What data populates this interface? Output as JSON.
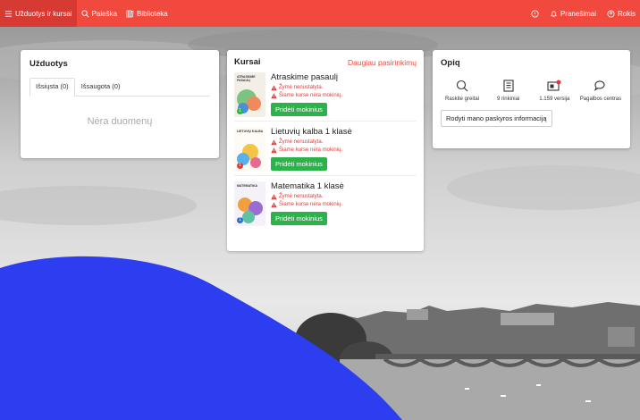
{
  "colors": {
    "brand": "#f2493f",
    "brand_dark": "#d73a32",
    "success": "#2bb34a",
    "warning": "#e53935",
    "blob": "#2c3ef0"
  },
  "topbar": {
    "items": [
      {
        "label": "Užduotys ir kursai",
        "icon": "list-icon"
      },
      {
        "label": "Paieška",
        "icon": "search-icon"
      },
      {
        "label": "Biblioteka",
        "icon": "books-icon"
      }
    ],
    "right": {
      "help_icon": "help-icon",
      "notifications_label": "Pranešimai",
      "user_label": "Rokis"
    }
  },
  "tasks": {
    "title": "Užduotys",
    "tabs": [
      "Išsiųsta (0)",
      "Išsaugota (0)"
    ],
    "empty_text": "Nėra duomenų"
  },
  "courses": {
    "title": "Kursai",
    "more_label": "Daugiau pasirinkimų",
    "items": [
      {
        "name": "Atraskime pasaulį",
        "cover_title": "ATRASKIME PASAULĮ",
        "grade": "1",
        "warn1": "Žymė nenustatyta.",
        "warn2": "Šiame kurse nėra mokinių.",
        "button": "Pridėti mokinius"
      },
      {
        "name": "Lietuvių kalba 1 klasė",
        "cover_title": "LIETUVIŲ KALBA",
        "grade": "1",
        "warn1": "Žymė nenustatyta.",
        "warn2": "Šiame kurse nėra mokinių.",
        "button": "Pridėti mokinius"
      },
      {
        "name": "Matematika 1 klasė",
        "cover_title": "MATEMATIKA",
        "grade": "1",
        "warn1": "Žymė nenustatyta.",
        "warn2": "Šiame kurse nėra mokinių.",
        "button": "Pridėti mokinius"
      }
    ]
  },
  "opiq": {
    "title": "Opiq",
    "items": [
      {
        "label": "Raskite greitai",
        "icon": "search-icon"
      },
      {
        "label": "9 rinkiniai",
        "icon": "collection-icon"
      },
      {
        "label": "1.159 versija",
        "icon": "version-icon"
      },
      {
        "label": "Pagalbos centras",
        "icon": "chat-icon"
      }
    ],
    "account_button": "Rodyti mano paskyros informaciją"
  }
}
